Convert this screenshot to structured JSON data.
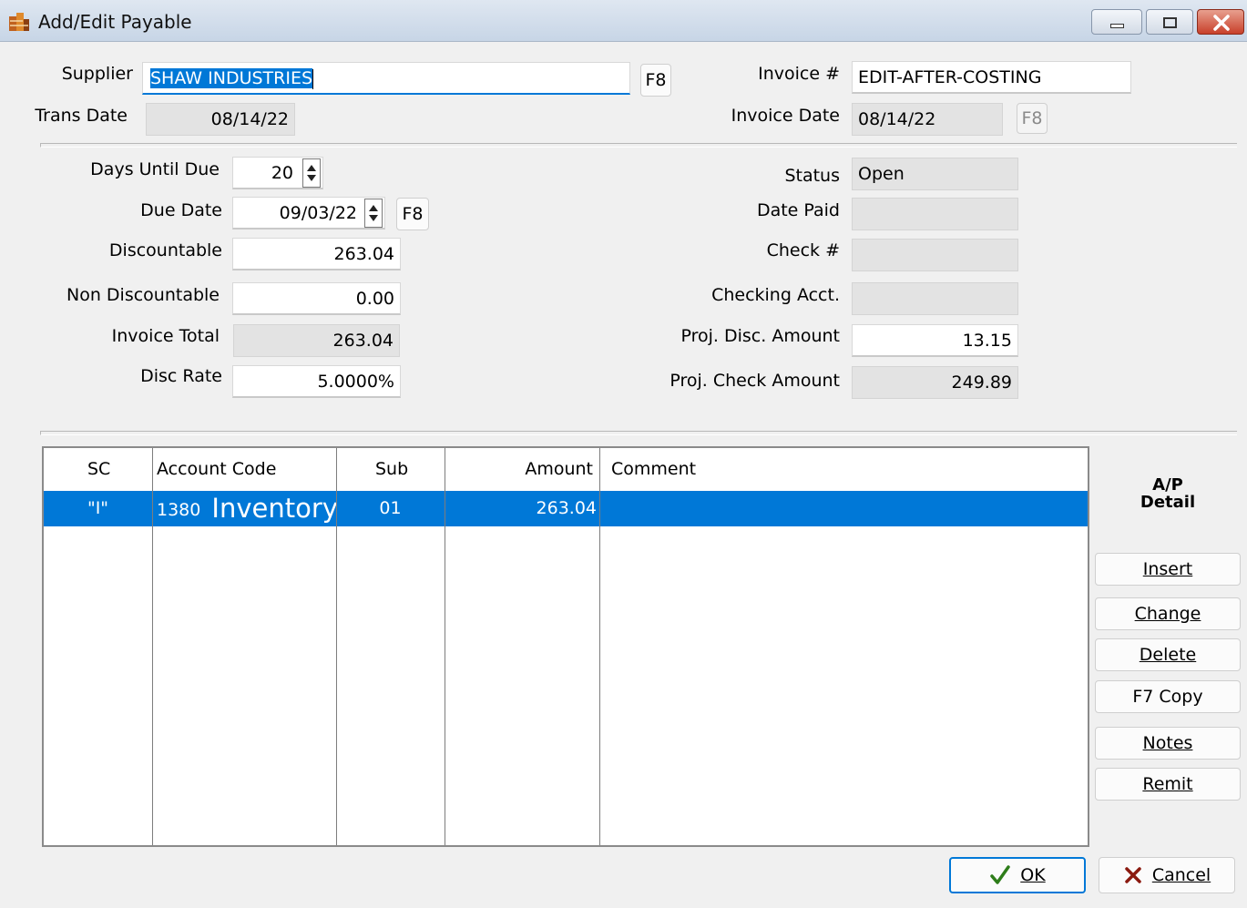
{
  "window": {
    "title": "Add/Edit Payable"
  },
  "header": {
    "supplier_label": "Supplier",
    "supplier_value": "SHAW INDUSTRIES",
    "supplier_lookup": "F8",
    "trans_date_label": "Trans Date",
    "trans_date_value": "08/14/22",
    "invoice_no_label": "Invoice #",
    "invoice_no_value": "EDIT-AFTER-COSTING",
    "invoice_date_label": "Invoice Date",
    "invoice_date_value": "08/14/22",
    "invoice_date_lookup": "F8"
  },
  "terms": {
    "days_until_due_label": "Days Until Due",
    "days_until_due_value": "20",
    "due_date_label": "Due Date",
    "due_date_value": "09/03/22",
    "due_date_lookup": "F8",
    "discountable_label": "Discountable",
    "discountable_value": "263.04",
    "non_discountable_label": "Non Discountable",
    "non_discountable_value": "0.00",
    "invoice_total_label": "Invoice Total",
    "invoice_total_value": "263.04",
    "disc_rate_label": "Disc Rate",
    "disc_rate_value": "5.0000%"
  },
  "status": {
    "status_label": "Status",
    "status_value": "Open",
    "date_paid_label": "Date Paid",
    "date_paid_value": "",
    "check_no_label": "Check #",
    "check_no_value": "",
    "checking_acct_label": "Checking Acct.",
    "checking_acct_value": "",
    "proj_disc_label": "Proj. Disc. Amount",
    "proj_disc_value": "13.15",
    "proj_check_label": "Proj. Check Amount",
    "proj_check_value": "249.89"
  },
  "grid": {
    "columns": [
      "SC",
      "Account Code",
      "Sub",
      "Amount",
      "Comment"
    ],
    "rows": [
      {
        "sc": "\"I\"",
        "account_code": "1380",
        "account_name": "Inventory",
        "sub": "01",
        "amount": "263.04",
        "comment": ""
      }
    ]
  },
  "side_panel": {
    "title_line1": "A/P",
    "title_line2": "Detail",
    "insert": "Insert",
    "change": "Change",
    "delete": "Delete",
    "copy": "F7 Copy",
    "notes": "Notes",
    "remit": "Remit"
  },
  "footer": {
    "ok": "OK",
    "cancel": "Cancel"
  },
  "colors": {
    "selection": "#0078d7",
    "title_bar": "#c7d5e6",
    "ok_check": "#2e7d1a",
    "cancel_x": "#8b1a10"
  }
}
